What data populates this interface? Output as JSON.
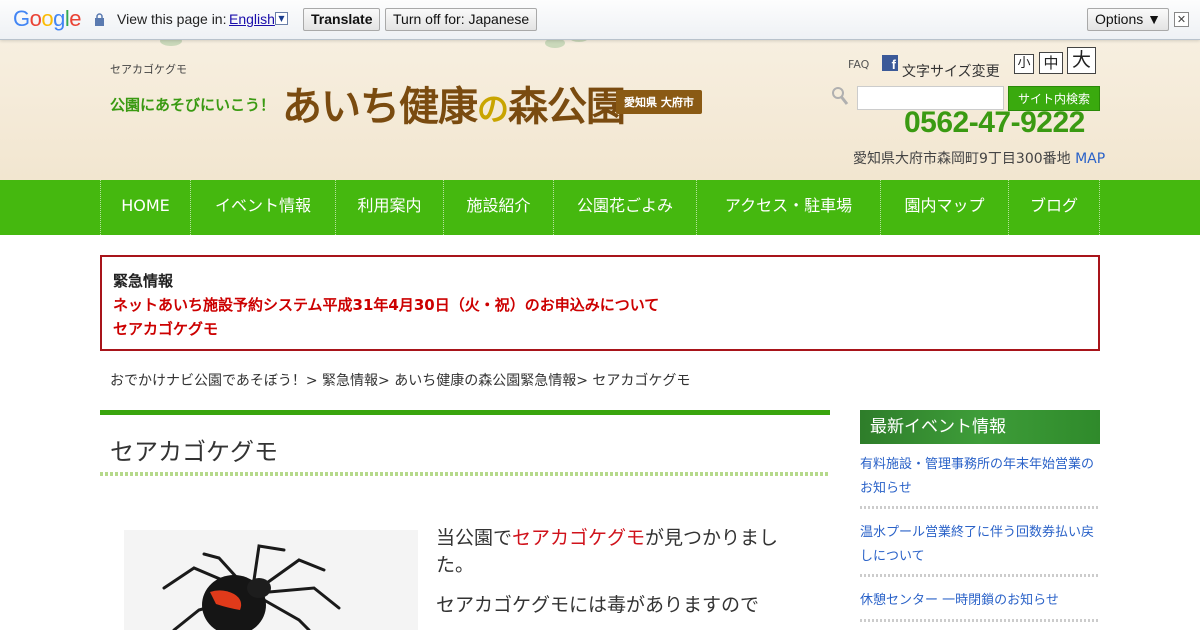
{
  "translate_bar": {
    "prompt": "View this page in:",
    "language": "English",
    "translate_button": "Translate",
    "turn_off_button": "Turn off for: Japanese",
    "options_button": "Options ▼",
    "close": "✕"
  },
  "header": {
    "site_name_small": "セアカゴケグモ",
    "tagline": "公園にあそびにいこう！",
    "logo_part1": "あいち健康",
    "logo_part2": "の",
    "logo_part3": "森公園",
    "location_badge": "愛知県 大府市",
    "faq": "FAQ",
    "fontsize_label": "文字サイズ変更",
    "fontsize_small": "小",
    "fontsize_medium": "中",
    "fontsize_large": "大",
    "search_placeholder": "",
    "search_button": "サイト内検索",
    "phone": "0562-47-9222",
    "address": "愛知県大府市森岡町9丁目300番地",
    "map_link": "MAP"
  },
  "nav": {
    "items": [
      "HOME",
      "イベント情報",
      "利用案内",
      "施設紹介",
      "公園花ごよみ",
      "アクセス・駐車場",
      "園内マップ",
      "ブログ"
    ]
  },
  "alert": {
    "title": "緊急情報",
    "links": [
      "ネットあいち施設予約システム平成31年4月30日（火・祝）のお申込みについて",
      "セアカゴケグモ"
    ]
  },
  "breadcrumb": "おでかけナビ公園であそぼう！> 緊急情報> あいち健康の森公園緊急情報> セアカゴケグモ",
  "main": {
    "title": "セアカゴケグモ",
    "para1_pre": "当公園で",
    "para1_hl": "セアカゴケグモ",
    "para1_post": "が見つかりまし",
    "para1_line2": "た。",
    "para2": "セアカゴケグモには毒がありますので"
  },
  "sidebar": {
    "heading": "最新イベント情報",
    "items": [
      [
        "有料施設・管理事務所の年末年始営業の",
        "お知らせ"
      ],
      [
        "温水プール営業終了に伴う回数券払い戻",
        "しについて"
      ],
      [
        "休憩センター 一時閉鎖のお知らせ"
      ]
    ]
  },
  "colors": {
    "nav_green": "#45b80f",
    "brand_brown": "#7a4b10",
    "alert_red": "#c00000",
    "link_blue": "#2a62c8"
  }
}
